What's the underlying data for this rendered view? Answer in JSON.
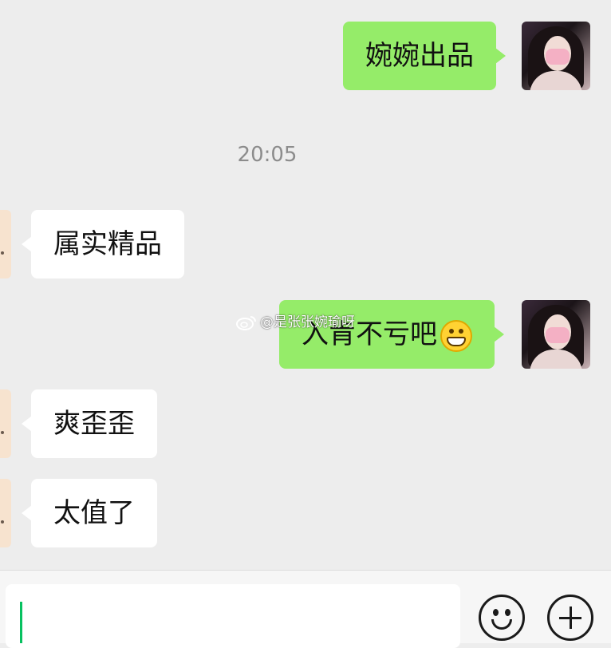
{
  "messages": [
    {
      "side": "me",
      "text": "婉婉出品"
    },
    {
      "side": "other",
      "text": "属实精品"
    },
    {
      "side": "me",
      "text": "入肯不亏吧",
      "emoji": "grinning-face"
    },
    {
      "side": "other",
      "text": "爽歪歪"
    },
    {
      "side": "other",
      "text": "太值了"
    }
  ],
  "timestamp": "20:05",
  "watermark": {
    "text": "@是张张婉瑜呀",
    "icon": "weibo-logo-icon"
  },
  "input_bar": {
    "value": "",
    "emoji_button": "emoji-icon",
    "plus_button": "plus-icon"
  },
  "colors": {
    "background": "#ededed",
    "my_bubble": "#95ec69",
    "other_bubble": "#ffffff",
    "caret": "#07c160"
  }
}
